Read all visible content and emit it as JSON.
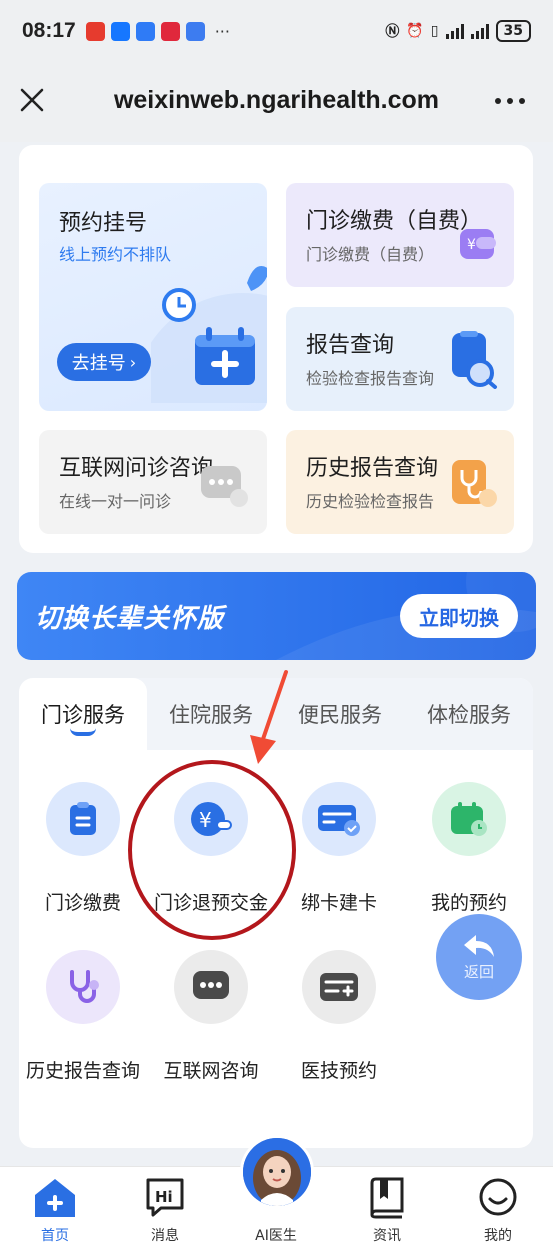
{
  "status_bar": {
    "time": "08:17",
    "battery": "35"
  },
  "browser": {
    "url": "weixinweb.ngarihealth.com"
  },
  "quick_tiles": {
    "registration": {
      "title": "预约挂号",
      "subtitle": "线上预约不排队",
      "button": "去挂号"
    },
    "outpatient_pay": {
      "title": "门诊缴费（自费）",
      "subtitle": "门诊缴费（自费）"
    },
    "report_query": {
      "title": "报告查询",
      "subtitle": "检验检查报告查询"
    },
    "online_consult": {
      "title": "互联网问诊咨询",
      "subtitle": "在线一对一问诊"
    },
    "history_report": {
      "title": "历史报告查询",
      "subtitle": "历史检验检查报告"
    }
  },
  "banner": {
    "text": "切换长辈关怀版",
    "button": "立即切换"
  },
  "service_tabs": [
    "门诊服务",
    "住院服务",
    "便民服务",
    "体检服务"
  ],
  "services": [
    {
      "label": "门诊缴费",
      "icon": "clipboard-icon"
    },
    {
      "label": "门诊退预交金",
      "icon": "yuan-refund-icon"
    },
    {
      "label": "绑卡建卡",
      "icon": "card-icon"
    },
    {
      "label": "我的预约",
      "icon": "calendar-icon"
    },
    {
      "label": "历史报告查询",
      "icon": "stethoscope-icon"
    },
    {
      "label": "互联网咨询",
      "icon": "chat-icon"
    },
    {
      "label": "医技预约",
      "icon": "medtech-card-icon"
    }
  ],
  "floating_back": "返回",
  "bottom_nav": [
    "首页",
    "消息",
    "AI医生",
    "资讯",
    "我的"
  ],
  "colors": {
    "primary": "#2a6fe3",
    "annotation_red": "#b3171c",
    "annotation_arrow": "#f04b35"
  }
}
